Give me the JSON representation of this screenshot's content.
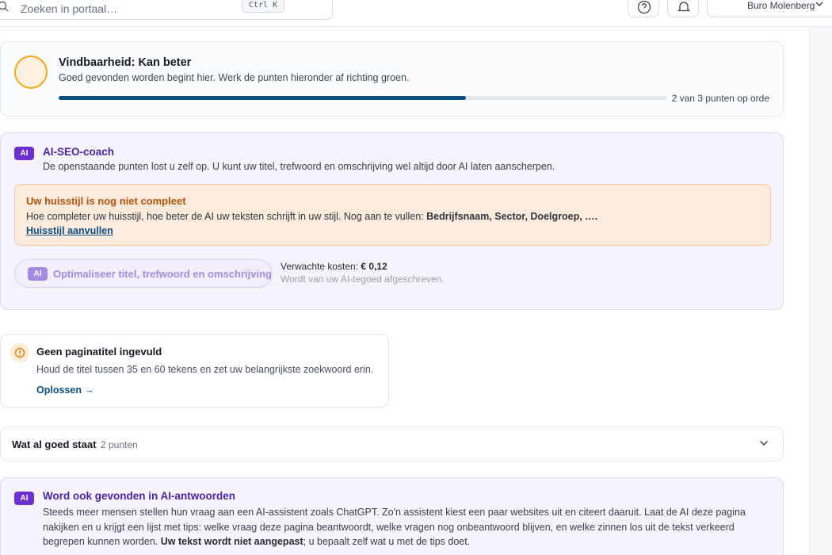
{
  "search": {
    "placeholder": "Zoeken in portaal…",
    "shortcut": "Ctrl K"
  },
  "header": {
    "account_name": "Buro Molenberg"
  },
  "status": {
    "title": "Vindbaarheid: Kan beter",
    "subtitle": "Goed gevonden worden begint hier. Werk de punten hieronder af richting groen.",
    "progress_fraction": 0.67,
    "progress_label": "2 van 3 punten op orde",
    "ring_color": "#f2a81d"
  },
  "coach": {
    "badge": "AI",
    "title": "AI-SEO-coach",
    "subtitle": "De openstaande punten lost u zelf op. U kunt uw titel, trefwoord en omschrijving wel altijd door AI laten aanscherpen.",
    "alert": {
      "title": "Uw huisstijl is nog niet compleet",
      "text_prefix": "Hoe completer uw huisstijl, hoe beter de AI uw teksten schrijft in uw stijl. Nog aan te vullen: ",
      "text_missing": "Bedrijfsnaam, Sector, Doelgroep, ….",
      "link": "Huisstijl aanvullen"
    },
    "optimize_button": {
      "badge": "AI",
      "label": "Optimaliseer titel, trefwoord en omschrijving"
    },
    "cost_label": "Verwachte kosten: ",
    "cost_value": "€ 0,12",
    "cost_note": "Wordt van uw AI-tegoed afgeschreven."
  },
  "issue": {
    "title": "Geen paginatitel ingevuld",
    "subtitle": "Houd de titel tussen 35 en 60 tekens en zet uw belangrijkste zoekwoord erin.",
    "fix_link": "Oplossen →"
  },
  "good": {
    "title": "Wat al goed staat",
    "count": "2 punten"
  },
  "geo": {
    "badge": "AI",
    "title": "Word ook gevonden in AI-antwoorden",
    "text_main": "Steeds meer mensen stellen hun vraag aan een AI-assistent zoals ChatGPT. Zo'n assistent kiest een paar websites uit en citeert daaruit. Laat de AI deze pagina nakijken en u krijgt een lijst met tips: welke vraag deze pagina beantwoordt, welke vragen nog onbeantwoord blijven, en welke zinnen los uit de tekst verkeerd begrepen kunnen worden. ",
    "text_bold": "Uw tekst wordt niet aangepast",
    "text_end": "; u bepaalt zelf wat u met de tips doet."
  },
  "colors": {
    "accent_blue": "#0c4f86",
    "ai_purple": "#6d2fd1",
    "warning_orange": "#b45309"
  }
}
